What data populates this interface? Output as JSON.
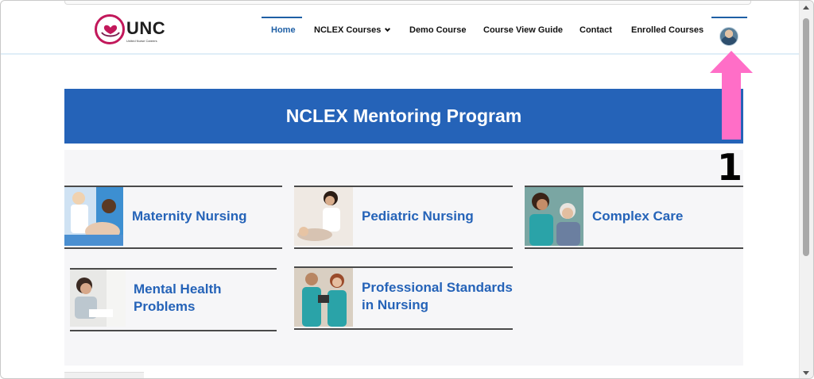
{
  "logo": {
    "text": "UNC",
    "subtext": "United Nurse Careers"
  },
  "nav": {
    "items": [
      {
        "label": "Home",
        "active": true
      },
      {
        "label": "NCLEX Courses",
        "has_dropdown": true
      },
      {
        "label": "Demo Course"
      },
      {
        "label": "Course View Guide"
      },
      {
        "label": "Contact"
      },
      {
        "label": "Enrolled Courses"
      }
    ],
    "avatar_icon": "user-avatar"
  },
  "banner": {
    "title": "NCLEX Mentoring Program"
  },
  "courses": [
    {
      "title": "Maternity Nursing",
      "image_icon": "maternity-photo"
    },
    {
      "title": "Pediatric Nursing",
      "image_icon": "pediatric-photo"
    },
    {
      "title": "Complex Care",
      "image_icon": "complex-care-photo"
    },
    {
      "title": "Mental Health Problems",
      "title_lines": [
        "Mental Health",
        "Problems"
      ],
      "image_icon": "mental-health-photo"
    },
    {
      "title": "Professional Standards in Nursing",
      "title_lines": [
        "Professional Standards",
        "in Nursing"
      ],
      "image_icon": "professional-standards-photo"
    }
  ],
  "annotation": {
    "label": "1",
    "color": "#ff6ec7"
  },
  "colors": {
    "accent": "#2563b8",
    "nav_active": "#1e5fa5",
    "panel_bg": "#f6f6f8"
  }
}
